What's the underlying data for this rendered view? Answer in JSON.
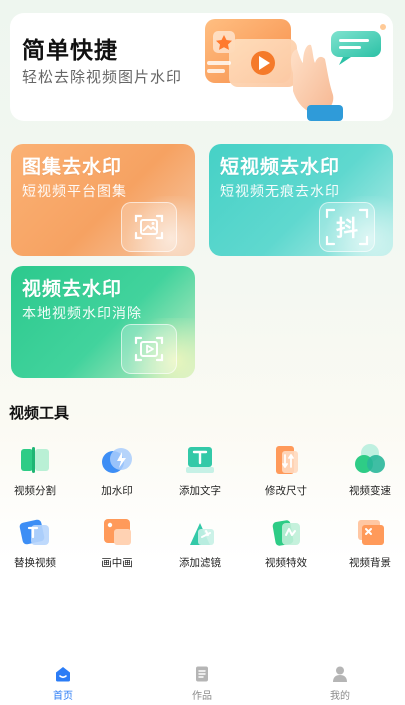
{
  "banner": {
    "title": "简单快捷",
    "subtitle": "轻松去除视频图片水印"
  },
  "cards": [
    {
      "title": "图集去水印",
      "subtitle": "短视频平台图集",
      "icon": "image-icon"
    },
    {
      "title": "短视频去水印",
      "subtitle": "短视频无痕去水印",
      "icon": "douyin-icon",
      "icon_text": "抖"
    },
    {
      "title": "视频去水印",
      "subtitle": "本地视频水印消除",
      "icon": "play-icon"
    }
  ],
  "tools_section": {
    "title": "视频工具",
    "items": [
      {
        "label": "视频分割",
        "icon": "split-icon"
      },
      {
        "label": "加水印",
        "icon": "add-watermark-icon"
      },
      {
        "label": "添加文字",
        "icon": "text-icon"
      },
      {
        "label": "修改尺寸",
        "icon": "resize-icon"
      },
      {
        "label": "视频变速",
        "icon": "speed-icon"
      },
      {
        "label": "替换视频",
        "icon": "replace-icon"
      },
      {
        "label": "画中画",
        "icon": "pip-icon"
      },
      {
        "label": "添加滤镜",
        "icon": "filter-icon"
      },
      {
        "label": "视频特效",
        "icon": "effects-icon"
      },
      {
        "label": "视频背景",
        "icon": "background-icon"
      }
    ]
  },
  "nav": {
    "items": [
      {
        "label": "首页",
        "icon": "home-icon",
        "active": true
      },
      {
        "label": "作品",
        "icon": "works-icon",
        "active": false
      },
      {
        "label": "我的",
        "icon": "profile-icon",
        "active": false
      }
    ]
  },
  "colors": {
    "accent": "#2b7cf6",
    "card1": "#f6a262",
    "card2": "#46d1c6",
    "card3": "#2cc98d"
  }
}
